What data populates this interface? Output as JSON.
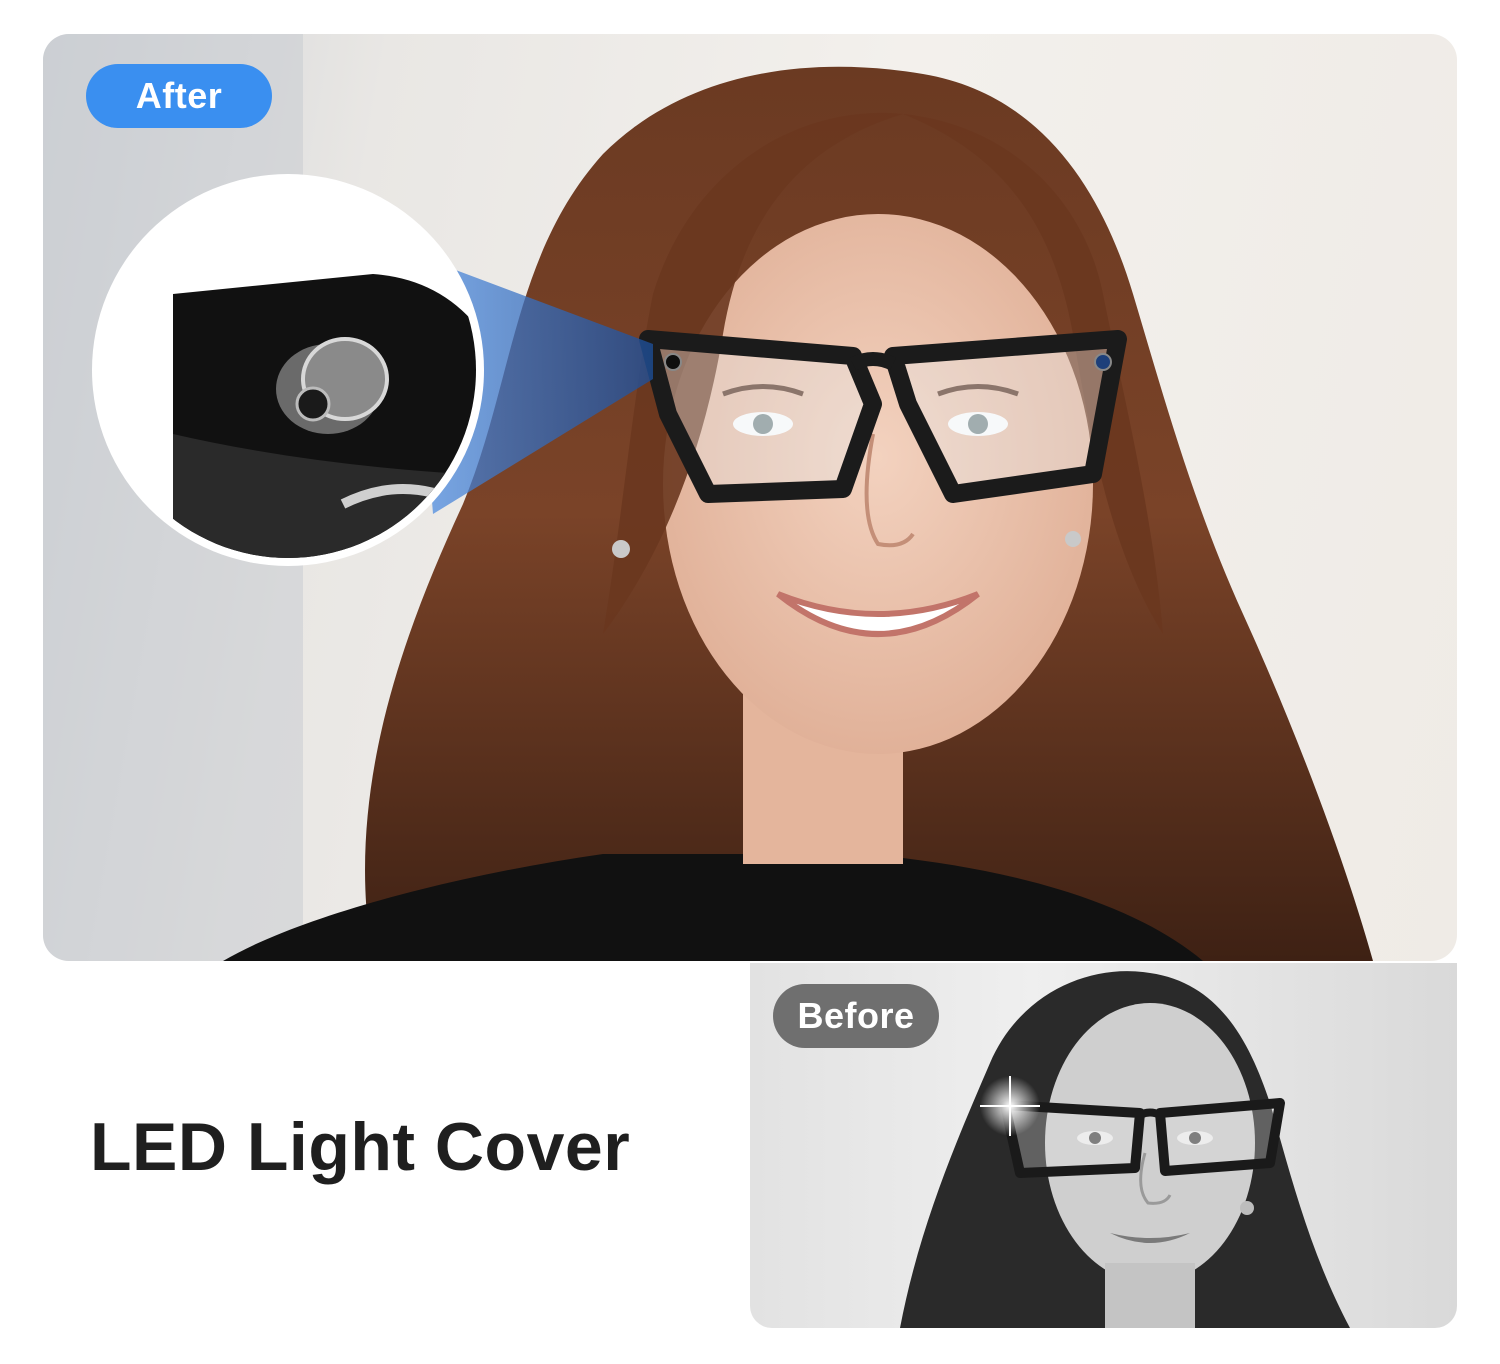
{
  "badges": {
    "after": "After",
    "before": "Before"
  },
  "headline": "LED Light Cover",
  "colors": {
    "after_badge": "#3a8ff0",
    "before_badge": "#6f6f6f",
    "headline": "#1f1f1f",
    "zoom_highlight": "#4f8fe6"
  },
  "icons": {
    "zoom_inset": "camera-lens-closeup-icon"
  }
}
